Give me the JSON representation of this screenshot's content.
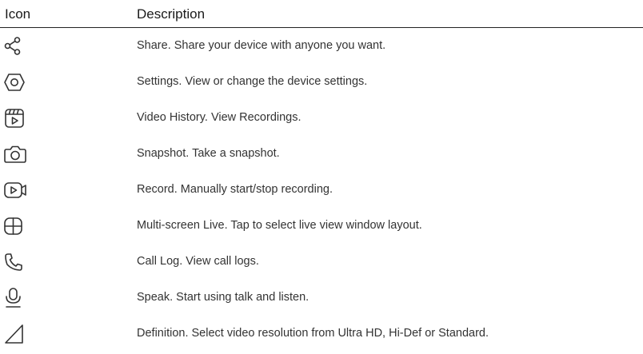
{
  "table": {
    "headers": {
      "icon": "Icon",
      "description": "Description"
    },
    "rows": [
      {
        "icon": "share-icon",
        "description": "Share. Share your device with anyone you want."
      },
      {
        "icon": "settings-icon",
        "description": "Settings. View or change the device settings."
      },
      {
        "icon": "video-history-icon",
        "description": "Video History. View Recordings."
      },
      {
        "icon": "camera-icon",
        "description": "Snapshot. Take a snapshot."
      },
      {
        "icon": "record-icon",
        "description": "Record. Manually start/stop recording."
      },
      {
        "icon": "multi-screen-icon",
        "description": "Multi-screen Live. Tap to select live view window layout."
      },
      {
        "icon": "phone-icon",
        "description": "Call Log. View call logs."
      },
      {
        "icon": "microphone-icon",
        "description": "Speak. Start using talk and listen."
      },
      {
        "icon": "definition-icon",
        "description": "Definition. Select video resolution from Ultra HD, Hi-Def or Standard."
      }
    ]
  }
}
